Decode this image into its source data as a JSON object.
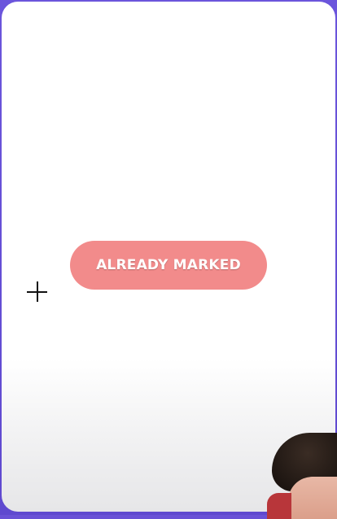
{
  "button": {
    "label": "ALREADY MARKED",
    "background_color": "#f28b8b",
    "text_color": "#ffffff"
  },
  "cursor": {
    "icon": "crosshair-icon"
  },
  "theme": {
    "frame_color": "#6a52d6",
    "screen_color": "#ffffff"
  }
}
